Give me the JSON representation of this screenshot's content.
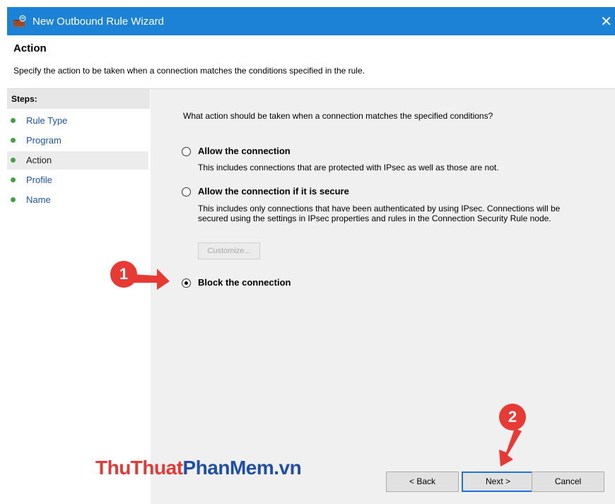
{
  "window": {
    "title": "New Outbound Rule Wizard",
    "close_glyph": "✕",
    "icon": "firewall-icon"
  },
  "header": {
    "title": "Action",
    "description": "Specify the action to be taken when a connection matches the conditions specified in the rule."
  },
  "steps": {
    "header": "Steps:",
    "items": [
      {
        "label": "Rule Type",
        "current": false
      },
      {
        "label": "Program",
        "current": false
      },
      {
        "label": "Action",
        "current": true
      },
      {
        "label": "Profile",
        "current": false
      },
      {
        "label": "Name",
        "current": false
      }
    ]
  },
  "main": {
    "question": "What action should be taken when a connection matches the specified conditions?",
    "options": [
      {
        "label": "Allow the connection",
        "description": "This includes connections that are protected with IPsec as well as those are not.",
        "selected": false
      },
      {
        "label": "Allow the connection if it is secure",
        "description": "This includes only connections that have been authenticated by using IPsec.  Connections will be secured using the settings in IPsec properties and rules in the Connection Security Rule node.",
        "selected": false
      },
      {
        "label": "Block the connection",
        "description": "",
        "selected": true
      }
    ],
    "customize_label": "Customize..."
  },
  "buttons": {
    "back": "< Back",
    "next": "Next >",
    "cancel": "Cancel"
  },
  "annotations": {
    "badge1": "1",
    "badge2": "2",
    "color": "#e83a34"
  },
  "watermark": {
    "part1": "ThuThuat",
    "part2": "PhanMem.vn"
  },
  "colors": {
    "titlebar": "#1b82d6",
    "link": "#1a55a8",
    "step_dot": "#3fa33f"
  }
}
